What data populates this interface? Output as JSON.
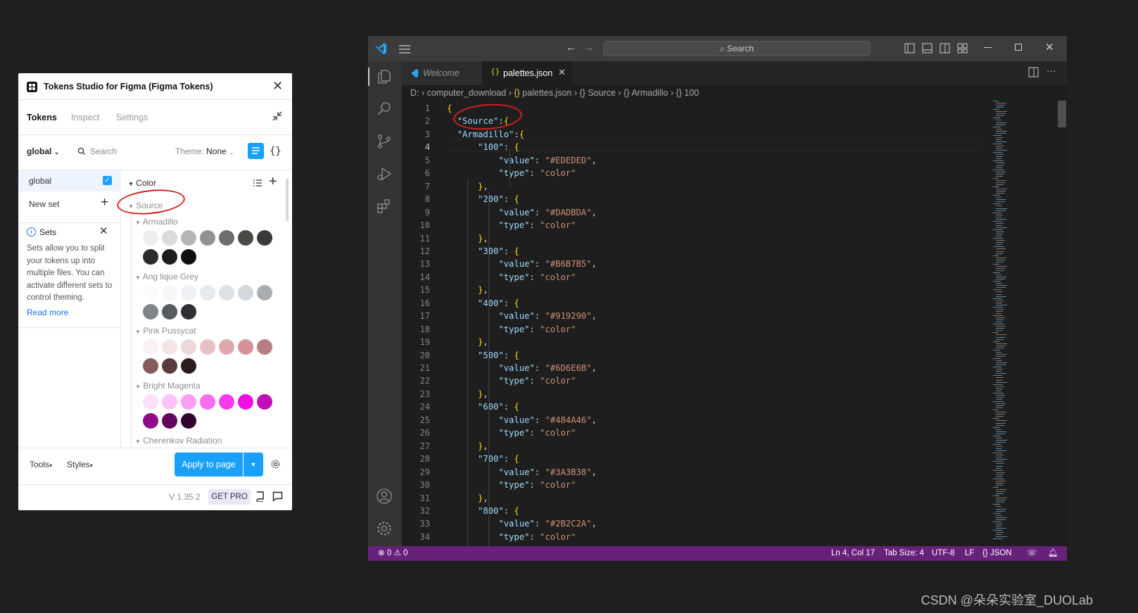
{
  "plugin": {
    "title": "Tokens Studio for Figma (Figma Tokens)",
    "tabs": [
      "Tokens",
      "Inspect",
      "Settings"
    ],
    "active_tab": "Tokens",
    "set_selector": "global",
    "search_label": "Search",
    "theme_label": "Theme:",
    "theme_value": "None",
    "sets": [
      {
        "name": "global",
        "checked": true
      }
    ],
    "new_set_label": "New set",
    "info": {
      "title": "Sets",
      "body": "Sets allow you to split your tokens up into multiple files. You can activate different sets to control theming.",
      "link": "Read more"
    },
    "tree": {
      "root": "Color",
      "child": "Source",
      "groups": [
        {
          "name": "Armadillo",
          "swatches": [
            "#EDEDED",
            "#DADBDA",
            "#B6B7B5",
            "#919290",
            "#6D6E6B",
            "#484A46",
            "#3A3B38",
            "#2B2C2A",
            "#1D1E1C",
            "#0E0F0E"
          ]
        },
        {
          "name": "Ang lique Grey",
          "swatches": [
            "#FBFBFC",
            "#F5F6F8",
            "#EEF0F3",
            "#E6E9ED",
            "#DDE1E6",
            "#D3D8DF",
            "#A9ADB2",
            "#80848A",
            "#575A5F",
            "#2E3033"
          ]
        },
        {
          "name": "Pink Pussycat",
          "swatches": [
            "#F9F1F1",
            "#F3E5E6",
            "#EDD8D9",
            "#E6C1C3",
            "#DFA8AB",
            "#D69297",
            "#B87E81",
            "#855B5C",
            "#573B3C",
            "#2B1D1D"
          ]
        },
        {
          "name": "Bright Magenta",
          "swatches": [
            "#FDE0FC",
            "#FCC2F9",
            "#FA9FF6",
            "#F86EF2",
            "#F63BEE",
            "#F00DE6",
            "#C00FB8",
            "#900B8A",
            "#60075C",
            "#30042E"
          ]
        },
        {
          "name": "Cherenkov Radiation",
          "swatches": []
        }
      ]
    },
    "footer": {
      "tools": "Tools",
      "styles": "Styles",
      "apply": "Apply to page",
      "version": "V 1.35.2",
      "get_pro": "GET PRO"
    }
  },
  "vscode": {
    "search": "Search",
    "tabs": [
      {
        "label": "Welcome",
        "active": false
      },
      {
        "label": "palettes.json",
        "active": true
      }
    ],
    "breadcrumb": [
      "D:",
      "computer_download",
      "palettes.json",
      "Source",
      "Armadillo",
      "100"
    ],
    "code_lines": [
      {
        "n": "1",
        "t": "{"
      },
      {
        "n": "2",
        "t": "  \"Source\":{"
      },
      {
        "n": "3",
        "t": "  \"Armadillo\":{"
      },
      {
        "n": "4",
        "t": "      \"100\": {"
      },
      {
        "n": "5",
        "t": "          \"value\": \"#EDEDED\","
      },
      {
        "n": "6",
        "t": "          \"type\": \"color\""
      },
      {
        "n": "7",
        "t": "      },"
      },
      {
        "n": "8",
        "t": "      \"200\": {"
      },
      {
        "n": "9",
        "t": "          \"value\": \"#DADBDA\","
      },
      {
        "n": "10",
        "t": "          \"type\": \"color\""
      },
      {
        "n": "11",
        "t": "      },"
      },
      {
        "n": "12",
        "t": "      \"300\": {"
      },
      {
        "n": "13",
        "t": "          \"value\": \"#B6B7B5\","
      },
      {
        "n": "14",
        "t": "          \"type\": \"color\""
      },
      {
        "n": "15",
        "t": "      },"
      },
      {
        "n": "16",
        "t": "      \"400\": {"
      },
      {
        "n": "17",
        "t": "          \"value\": \"#919290\","
      },
      {
        "n": "18",
        "t": "          \"type\": \"color\""
      },
      {
        "n": "19",
        "t": "      },"
      },
      {
        "n": "20",
        "t": "      \"500\": {"
      },
      {
        "n": "21",
        "t": "          \"value\": \"#6D6E6B\","
      },
      {
        "n": "22",
        "t": "          \"type\": \"color\""
      },
      {
        "n": "23",
        "t": "      },"
      },
      {
        "n": "24",
        "t": "      \"600\": {"
      },
      {
        "n": "25",
        "t": "          \"value\": \"#484A46\","
      },
      {
        "n": "26",
        "t": "          \"type\": \"color\""
      },
      {
        "n": "27",
        "t": "      },"
      },
      {
        "n": "28",
        "t": "      \"700\": {"
      },
      {
        "n": "29",
        "t": "          \"value\": \"#3A3B38\","
      },
      {
        "n": "30",
        "t": "          \"type\": \"color\""
      },
      {
        "n": "31",
        "t": "      },"
      },
      {
        "n": "32",
        "t": "      \"800\": {"
      },
      {
        "n": "33",
        "t": "          \"value\": \"#2B2C2A\","
      },
      {
        "n": "34",
        "t": "          \"type\": \"color\""
      }
    ],
    "status": {
      "errors": "0",
      "warnings": "0",
      "position": "Ln 4, Col 17",
      "tab_size": "Tab Size: 4",
      "encoding": "UTF-8",
      "eol": "LF",
      "language": "JSON"
    },
    "accent": "#68217A"
  },
  "watermark": "CSDN @朵朵实验室_DUOLab"
}
